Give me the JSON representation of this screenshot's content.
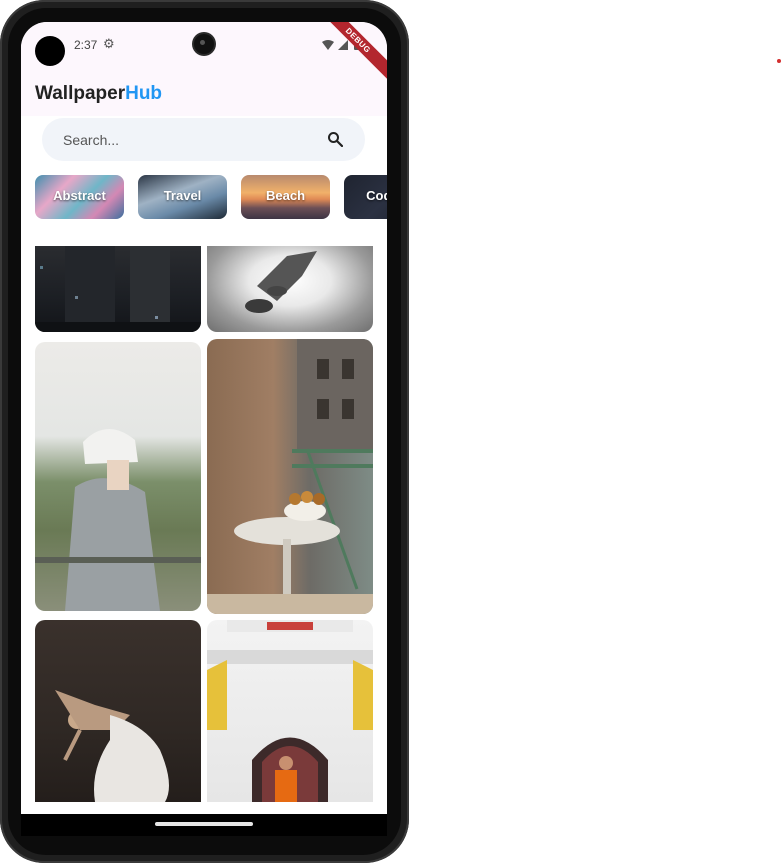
{
  "status_bar": {
    "time": "2:37",
    "settings_icon": "gear-icon",
    "wifi_icon": "wifi-icon",
    "signal_icon": "signal-icon",
    "battery_icon": "battery-icon",
    "debug_banner": "DEBUG"
  },
  "header": {
    "title_part1": "Wallpaper",
    "title_part2": "Hub",
    "accent_color": "#2196f3"
  },
  "search": {
    "placeholder": "Search...",
    "icon": "search-icon"
  },
  "categories": [
    {
      "label": "Abstract"
    },
    {
      "label": "Travel"
    },
    {
      "label": "Beach"
    },
    {
      "label": "Coding"
    }
  ],
  "wallpapers": [
    {
      "description": "city building at night"
    },
    {
      "description": "black and white figure in spotlight"
    },
    {
      "description": "person in white hat with camera"
    },
    {
      "description": "fruit bowl on round table by balcony"
    },
    {
      "description": "ballet dancer"
    },
    {
      "description": "monk at temple doorway"
    }
  ]
}
